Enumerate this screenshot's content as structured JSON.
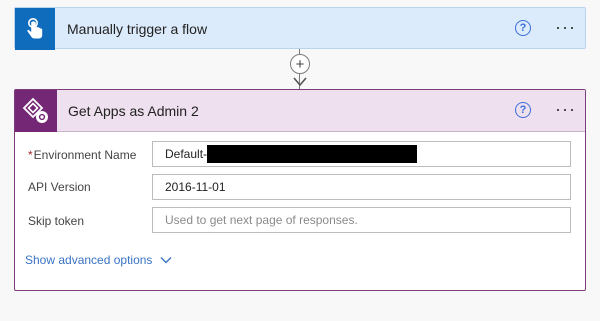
{
  "trigger": {
    "title": "Manually trigger a flow",
    "help_glyph": "?",
    "more_glyph": "···",
    "accent": "#0f6cbd",
    "background": "#dcebfb"
  },
  "connector": {
    "add_glyph": "+"
  },
  "action": {
    "title": "Get Apps as Admin 2",
    "help_glyph": "?",
    "more_glyph": "···",
    "accent": "#742774",
    "background": "#eee0ee",
    "fields": [
      {
        "label": "Environment Name",
        "required": true,
        "required_mark": "*",
        "value": "Default-",
        "redacted": true,
        "placeholder": ""
      },
      {
        "label": "API Version",
        "required": false,
        "value": "2016-11-01",
        "placeholder": ""
      },
      {
        "label": "Skip token",
        "required": false,
        "value": "",
        "placeholder": "Used to get next page of responses."
      }
    ],
    "advanced_label": "Show advanced options"
  },
  "icons": {
    "trigger": "touch-hand-icon",
    "action": "powerapps-admin-icon",
    "help": "help-circle-icon",
    "more": "ellipsis-icon",
    "add": "plus-circle-icon",
    "advanced": "chevron-down-icon"
  }
}
